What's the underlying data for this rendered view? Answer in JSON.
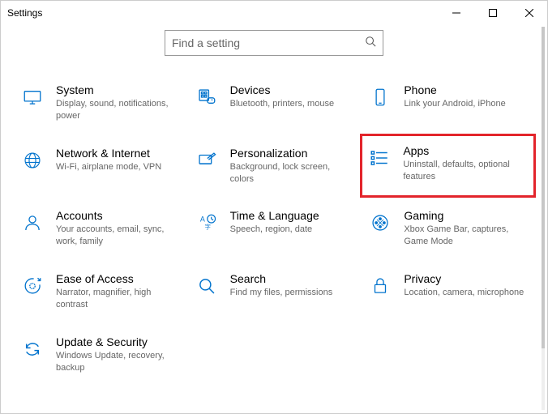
{
  "window": {
    "title": "Settings"
  },
  "search": {
    "placeholder": "Find a setting"
  },
  "tiles": [
    {
      "key": "system",
      "title": "System",
      "desc": "Display, sound, notifications, power"
    },
    {
      "key": "devices",
      "title": "Devices",
      "desc": "Bluetooth, printers, mouse"
    },
    {
      "key": "phone",
      "title": "Phone",
      "desc": "Link your Android, iPhone"
    },
    {
      "key": "network",
      "title": "Network & Internet",
      "desc": "Wi-Fi, airplane mode, VPN"
    },
    {
      "key": "personalization",
      "title": "Personalization",
      "desc": "Background, lock screen, colors"
    },
    {
      "key": "apps",
      "title": "Apps",
      "desc": "Uninstall, defaults, optional features"
    },
    {
      "key": "accounts",
      "title": "Accounts",
      "desc": "Your accounts, email, sync, work, family"
    },
    {
      "key": "time",
      "title": "Time & Language",
      "desc": "Speech, region, date"
    },
    {
      "key": "gaming",
      "title": "Gaming",
      "desc": "Xbox Game Bar, captures, Game Mode"
    },
    {
      "key": "ease",
      "title": "Ease of Access",
      "desc": "Narrator, magnifier, high contrast"
    },
    {
      "key": "search-cat",
      "title": "Search",
      "desc": "Find my files, permissions"
    },
    {
      "key": "privacy",
      "title": "Privacy",
      "desc": "Location, camera, microphone"
    },
    {
      "key": "update",
      "title": "Update & Security",
      "desc": "Windows Update, recovery, backup"
    }
  ],
  "highlighted": "apps"
}
